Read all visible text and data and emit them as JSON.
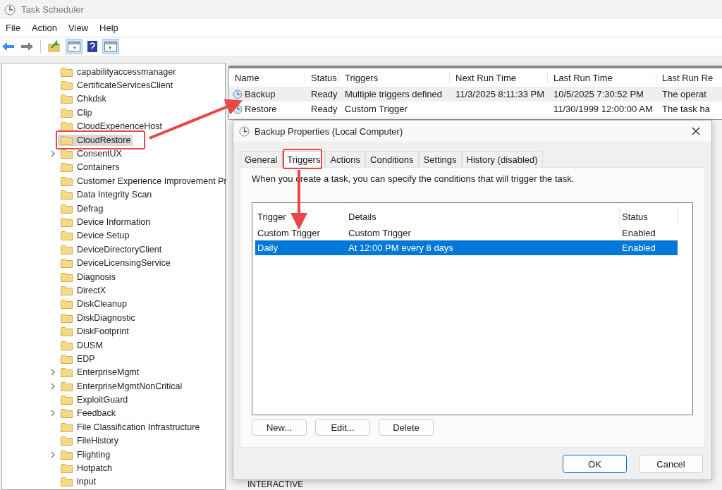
{
  "window": {
    "title": "Task Scheduler"
  },
  "menu": [
    "File",
    "Action",
    "View",
    "Help"
  ],
  "tree": {
    "items": [
      {
        "label": "capabilityaccessmanager",
        "expandable": false,
        "selected": false
      },
      {
        "label": "CertificateServicesClient",
        "expandable": false,
        "selected": false
      },
      {
        "label": "Chkdsk",
        "expandable": false,
        "selected": false
      },
      {
        "label": "Clip",
        "expandable": false,
        "selected": false
      },
      {
        "label": "CloudExperienceHost",
        "expandable": false,
        "selected": false
      },
      {
        "label": "CloudRestore",
        "expandable": false,
        "selected": true
      },
      {
        "label": "ConsentUX",
        "expandable": true,
        "selected": false
      },
      {
        "label": "Containers",
        "expandable": false,
        "selected": false
      },
      {
        "label": "Customer Experience Improvement Pr",
        "expandable": false,
        "selected": false
      },
      {
        "label": "Data Integrity Scan",
        "expandable": false,
        "selected": false
      },
      {
        "label": "Defrag",
        "expandable": false,
        "selected": false
      },
      {
        "label": "Device Information",
        "expandable": false,
        "selected": false
      },
      {
        "label": "Device Setup",
        "expandable": false,
        "selected": false
      },
      {
        "label": "DeviceDirectoryClient",
        "expandable": false,
        "selected": false
      },
      {
        "label": "DeviceLicensingService",
        "expandable": false,
        "selected": false
      },
      {
        "label": "Diagnosis",
        "expandable": false,
        "selected": false
      },
      {
        "label": "DirectX",
        "expandable": false,
        "selected": false
      },
      {
        "label": "DiskCleanup",
        "expandable": false,
        "selected": false
      },
      {
        "label": "DiskDiagnostic",
        "expandable": false,
        "selected": false
      },
      {
        "label": "DiskFootprint",
        "expandable": false,
        "selected": false
      },
      {
        "label": "DUSM",
        "expandable": false,
        "selected": false
      },
      {
        "label": "EDP",
        "expandable": false,
        "selected": false
      },
      {
        "label": "EnterpriseMgmt",
        "expandable": true,
        "selected": false
      },
      {
        "label": "EnterpriseMgmtNonCritical",
        "expandable": true,
        "selected": false
      },
      {
        "label": "ExploitGuard",
        "expandable": false,
        "selected": false
      },
      {
        "label": "Feedback",
        "expandable": true,
        "selected": false
      },
      {
        "label": "File Classification Infrastructure",
        "expandable": false,
        "selected": false
      },
      {
        "label": "FileHistory",
        "expandable": false,
        "selected": false
      },
      {
        "label": "Flighting",
        "expandable": true,
        "selected": false
      },
      {
        "label": "Hotpatch",
        "expandable": false,
        "selected": false
      },
      {
        "label": "input",
        "expandable": false,
        "selected": false
      }
    ]
  },
  "tasks": {
    "columns": [
      "Name",
      "Status",
      "Triggers",
      "Next Run Time",
      "Last Run Time",
      "Last Run Re"
    ],
    "rows": [
      {
        "cells": [
          "Backup",
          "Ready",
          "Multiple triggers defined",
          "11/3/2025 8:11:33 PM",
          "10/5/2025 7:30:52 PM",
          "The operat"
        ],
        "selected": true
      },
      {
        "cells": [
          "Restore",
          "Ready",
          "Custom Trigger",
          "",
          "11/30/1999 12:00:00 AM",
          "The task ha"
        ],
        "selected": false
      }
    ]
  },
  "bottom_text": "INTERACTIVE",
  "dialog": {
    "title": "Backup Properties (Local Computer)",
    "tabs": [
      {
        "label": "General",
        "selected": false
      },
      {
        "label": "Triggers",
        "selected": true
      },
      {
        "label": "Actions",
        "selected": false
      },
      {
        "label": "Conditions",
        "selected": false
      },
      {
        "label": "Settings",
        "selected": false
      },
      {
        "label": "History (disabled)",
        "selected": false
      }
    ],
    "description": "When you create a task, you can specify the conditions that will trigger the task.",
    "triggers": {
      "columns": [
        "Trigger",
        "Details",
        "Status"
      ],
      "rows": [
        {
          "cells": [
            "Custom Trigger",
            "Custom Trigger",
            "Enabled"
          ],
          "selected": false
        },
        {
          "cells": [
            "Daily",
            "At 12:00 PM every 8 days",
            "Enabled"
          ],
          "selected": true
        }
      ]
    },
    "list_buttons": [
      "New...",
      "Edit...",
      "Delete"
    ],
    "buttons": [
      {
        "label": "OK",
        "kind": "default"
      },
      {
        "label": "Cancel",
        "kind": "normal"
      }
    ]
  }
}
